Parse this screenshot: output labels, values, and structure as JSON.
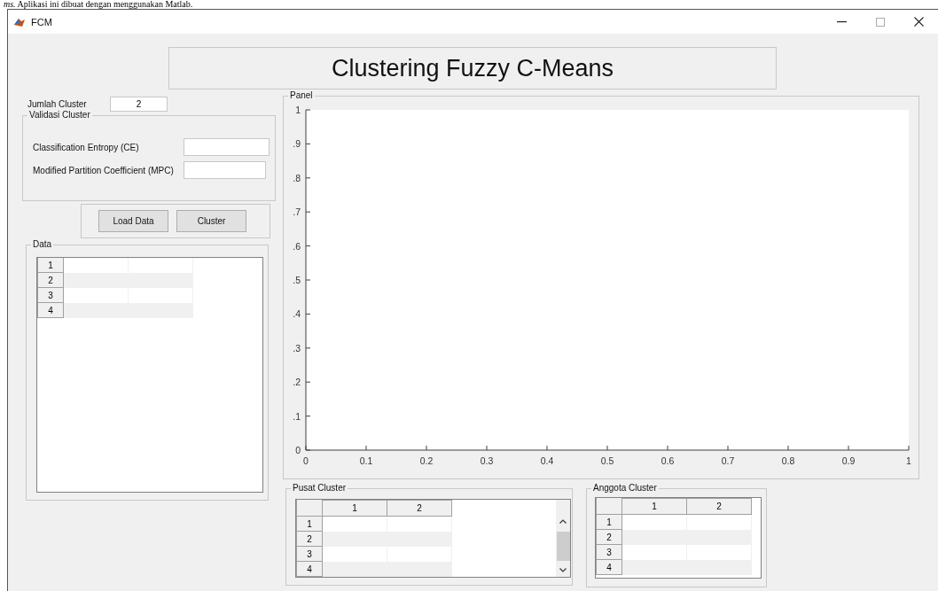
{
  "document_caption": "*ms.* Aplikasi ini dibuat dengan menggunakan Matlab.",
  "window": {
    "title": "FCM"
  },
  "heading": "Clustering Fuzzy C-Means",
  "cluster_count": {
    "label": "Jumlah Cluster",
    "value": "2"
  },
  "validation_panel": {
    "title": "Validasi Cluster",
    "fields": [
      {
        "label": "Classification Entropy (CE)"
      },
      {
        "label": "Modified Partition Coefficient (MPC)"
      }
    ]
  },
  "buttons": [
    "Load Data",
    "Cluster"
  ],
  "data_panel": {
    "title": "Data",
    "row_headers": [
      "1",
      "2",
      "3",
      "4"
    ]
  },
  "plot_panel": {
    "title": "Panel",
    "y_tick_labels": [
      "1",
      ".9",
      ".8",
      ".7",
      ".6",
      ".5",
      ".4",
      ".3",
      ".2",
      ".1",
      "0"
    ],
    "x_tick_labels": [
      "0",
      "0.1",
      "0.2",
      "0.3",
      "0.4",
      "0.5",
      "0.6",
      "0.7",
      "0.8",
      "0.9",
      "1"
    ]
  },
  "center_panel": {
    "title": "Pusat Cluster",
    "columns": [
      "1",
      "2"
    ],
    "row_headers": [
      "1",
      "2",
      "3",
      "4"
    ]
  },
  "member_panel": {
    "title": "Anggota Cluster",
    "columns": [
      "1",
      "2"
    ],
    "row_headers": [
      "1",
      "2",
      "3",
      "4"
    ]
  }
}
